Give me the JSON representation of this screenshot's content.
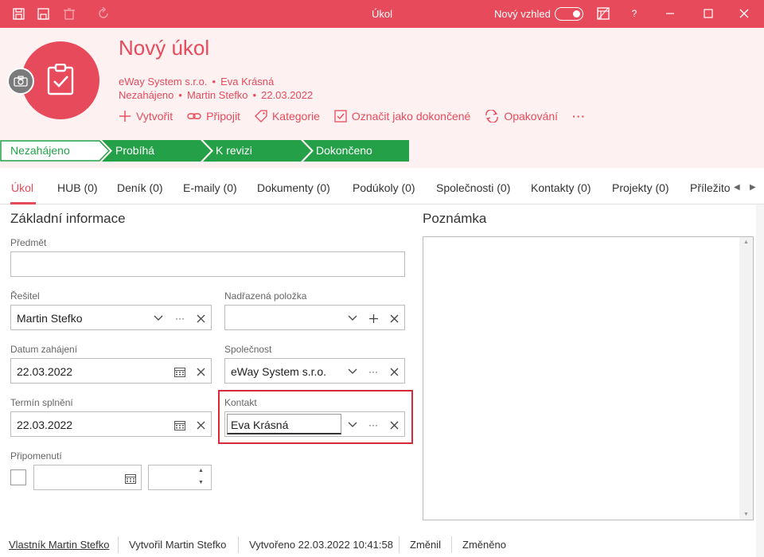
{
  "window": {
    "title": "Úkol",
    "new_look_label": "Nový vzhled",
    "help_label": "?"
  },
  "header": {
    "title": "Nový úkol",
    "line1": {
      "company": "eWay System s.r.o.",
      "person": "Eva Krásná"
    },
    "line2": {
      "state": "Nezahájeno",
      "person": "Martin Stefko",
      "date": "22.03.2022"
    },
    "separator": "•",
    "actions": [
      {
        "label": "Vytvořit",
        "icon": "plus-icon"
      },
      {
        "label": "Připojit",
        "icon": "link-icon"
      },
      {
        "label": "Kategorie",
        "icon": "tag-icon"
      },
      {
        "label": "Označit jako dokončené",
        "icon": "checkbox-icon"
      },
      {
        "label": "Opakování",
        "icon": "repeat-icon"
      }
    ],
    "more_label": "···"
  },
  "stages": [
    {
      "label": "Nezahájeno",
      "active": true
    },
    {
      "label": "Probíhá",
      "active": false
    },
    {
      "label": "K revizi",
      "active": false
    },
    {
      "label": "Dokončeno",
      "active": false
    }
  ],
  "tabs": [
    {
      "label": "Úkol",
      "active": true
    },
    {
      "label": "HUB (0)"
    },
    {
      "label": "Deník (0)"
    },
    {
      "label": "E-maily (0)"
    },
    {
      "label": "Dokumenty (0)"
    },
    {
      "label": "Podúkoly (0)"
    },
    {
      "label": "Společnosti (0)"
    },
    {
      "label": "Kontakty (0)"
    },
    {
      "label": "Projekty (0)"
    },
    {
      "label": "Příležito"
    }
  ],
  "form": {
    "section_title": "Základní informace",
    "subject": {
      "label": "Předmět",
      "value": ""
    },
    "solver": {
      "label": "Řešitel",
      "value": "Martin Stefko"
    },
    "parent": {
      "label": "Nadřazená položka",
      "value": ""
    },
    "start_date": {
      "label": "Datum zahájení",
      "value": "22.03.2022"
    },
    "company": {
      "label": "Společnost",
      "value": "eWay System s.r.o."
    },
    "due_date": {
      "label": "Termín splnění",
      "value": "22.03.2022"
    },
    "contact": {
      "label": "Kontakt",
      "value": "Eva Krásná"
    },
    "reminder": {
      "label": "Připomenutí",
      "date": "",
      "time": ""
    }
  },
  "note": {
    "title": "Poznámka",
    "value": ""
  },
  "footer": {
    "owner": "Vlastník Martin Stefko",
    "created_by": "Vytvořil Martin Stefko",
    "created": "Vytvořeno 22.03.2022 10:41:58",
    "changed_by": "Změnil",
    "changed": "Změněno"
  },
  "colors": {
    "accent": "#e74b5b",
    "stage_green": "#24a148",
    "highlight": "#d7293a"
  }
}
